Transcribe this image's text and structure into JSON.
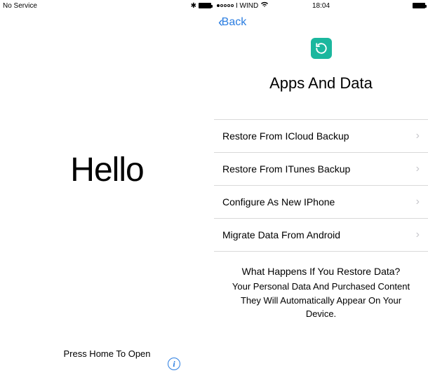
{
  "left": {
    "status": {
      "carrier": "No Service"
    },
    "hello": "Hello",
    "press_home": "Press Home To Open",
    "bluetooth_glyph": "⁕"
  },
  "right": {
    "status": {
      "carrier": "I WIND",
      "time": "18:04"
    },
    "back_label": "Back",
    "title": "Apps And Data",
    "options": [
      {
        "label": "Restore From ICloud Backup"
      },
      {
        "label": "Restore From ITunes Backup"
      },
      {
        "label": "Configure As New IPhone"
      },
      {
        "label": "Migrate Data From Android"
      }
    ],
    "footer": {
      "heading": "What Happens If You Restore Data?",
      "line1": "Your Personal Data And Purchased Content",
      "line2": "They Will Automatically Appear On Your",
      "line3": "Device."
    }
  }
}
